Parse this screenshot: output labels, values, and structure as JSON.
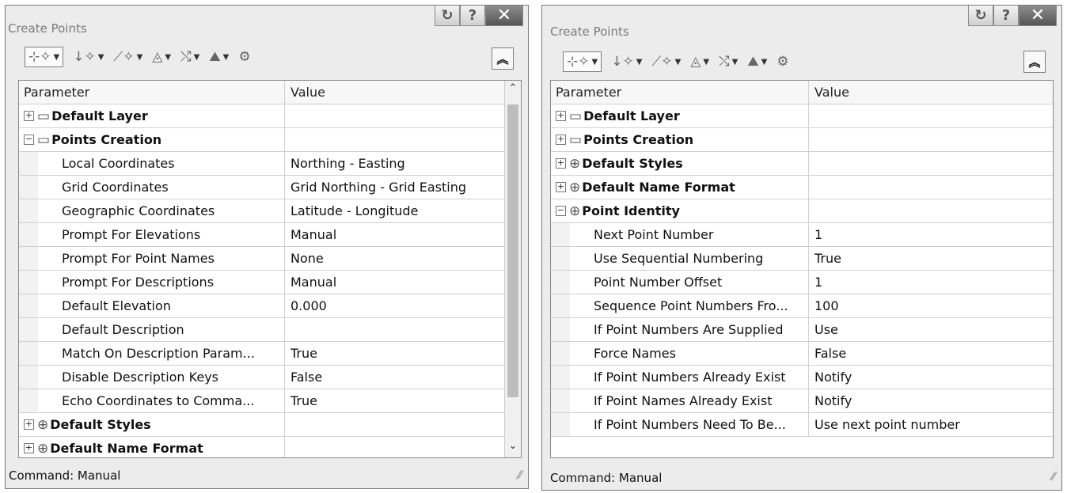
{
  "left": {
    "title": "Create Points",
    "columns": {
      "parameter": "Parameter",
      "value": "Value"
    },
    "rows": [
      {
        "kind": "cat",
        "expand": "⊞",
        "icon": "layer-icon",
        "label": "Default Layer",
        "value": ""
      },
      {
        "kind": "cat",
        "expand": "⊟",
        "icon": "layer-icon",
        "label": "Points Creation",
        "value": ""
      },
      {
        "kind": "prop",
        "label": "Local Coordinates",
        "value": "Northing - Easting"
      },
      {
        "kind": "prop",
        "label": "Grid Coordinates",
        "value": "Grid Northing - Grid Easting"
      },
      {
        "kind": "prop",
        "label": "Geographic Coordinates",
        "value": "Latitude - Longitude"
      },
      {
        "kind": "prop",
        "label": "Prompt For Elevations",
        "value": "Manual"
      },
      {
        "kind": "prop",
        "label": "Prompt For Point Names",
        "value": "None"
      },
      {
        "kind": "prop",
        "label": "Prompt For Descriptions",
        "value": "Manual"
      },
      {
        "kind": "prop",
        "label": "Default Elevation",
        "value": "0.000"
      },
      {
        "kind": "prop",
        "label": "Default Description",
        "value": ""
      },
      {
        "kind": "prop",
        "label": "Match On Description Param...",
        "value": "True"
      },
      {
        "kind": "prop",
        "label": "Disable Description Keys",
        "value": "False"
      },
      {
        "kind": "prop",
        "label": "Echo Coordinates to Comma...",
        "value": "True"
      },
      {
        "kind": "cat",
        "expand": "⊞",
        "icon": "point-icon",
        "label": "Default Styles",
        "value": ""
      },
      {
        "kind": "cat",
        "expand": "⊞",
        "icon": "point-icon",
        "label": "Default Name Format",
        "value": ""
      }
    ],
    "status": "Command: Manual"
  },
  "right": {
    "title": "Create Points",
    "columns": {
      "parameter": "Parameter",
      "value": "Value"
    },
    "rows": [
      {
        "kind": "cat",
        "expand": "⊞",
        "icon": "layer-icon",
        "label": "Default Layer",
        "value": ""
      },
      {
        "kind": "cat",
        "expand": "⊞",
        "icon": "layer-icon",
        "label": "Points Creation",
        "value": ""
      },
      {
        "kind": "cat",
        "expand": "⊞",
        "icon": "point-icon",
        "label": "Default Styles",
        "value": ""
      },
      {
        "kind": "cat",
        "expand": "⊞",
        "icon": "point-icon",
        "label": "Default Name Format",
        "value": ""
      },
      {
        "kind": "cat",
        "expand": "⊟",
        "icon": "point-icon",
        "label": "Point Identity",
        "value": ""
      },
      {
        "kind": "prop",
        "label": "Next Point Number",
        "value": "1"
      },
      {
        "kind": "prop",
        "label": "Use Sequential Numbering",
        "value": "True"
      },
      {
        "kind": "prop",
        "label": "Point Number Offset",
        "value": "1"
      },
      {
        "kind": "prop",
        "label": "Sequence Point Numbers Fro...",
        "value": "100"
      },
      {
        "kind": "prop",
        "label": "If Point Numbers Are Supplied",
        "value": "Use"
      },
      {
        "kind": "prop",
        "label": "Force Names",
        "value": "False"
      },
      {
        "kind": "prop",
        "label": "If Point Numbers Already Exist",
        "value": "Notify"
      },
      {
        "kind": "prop",
        "label": "If Point Names Already Exist",
        "value": "Notify"
      },
      {
        "kind": "prop",
        "label": "If Point Numbers Need To Be...",
        "value": "Use next point number"
      }
    ],
    "status": "Command: Manual"
  },
  "titlebar_buttons": {
    "help": "?",
    "close": "✕"
  },
  "toolbar": [
    "point-creation-tool",
    "point-insert-tool",
    "point-interpolation-tool",
    "point-slope-tool",
    "point-intersection-tool",
    "point-surface-tool",
    "point-settings-tool"
  ]
}
